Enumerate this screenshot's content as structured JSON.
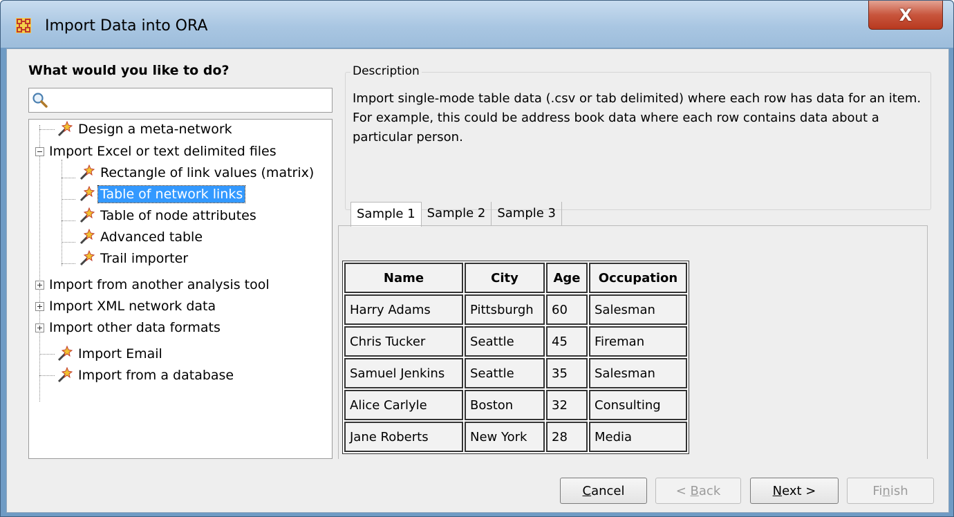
{
  "window": {
    "title": "Import Data into ORA",
    "close_label": "X",
    "accent_color": "#3399ff"
  },
  "left": {
    "heading": "What would you like to do?",
    "search_value": "",
    "tree": [
      {
        "label": "Design a meta-network",
        "icon": "wand-icon"
      },
      {
        "label": "Import Excel or text delimited files",
        "icon": "minus-expander",
        "expanded": true
      },
      {
        "label": "Rectangle of link values (matrix)",
        "icon": "wand-icon"
      },
      {
        "label": "Table of network links",
        "icon": "wand-icon",
        "selected": true
      },
      {
        "label": "Table of node attributes",
        "icon": "wand-icon"
      },
      {
        "label": "Advanced table",
        "icon": "wand-icon"
      },
      {
        "label": "Trail importer",
        "icon": "wand-icon"
      },
      {
        "label": "Import from another analysis tool",
        "icon": "plus-expander",
        "expanded": false
      },
      {
        "label": "Import XML network data",
        "icon": "plus-expander",
        "expanded": false
      },
      {
        "label": "Import other data formats",
        "icon": "plus-expander",
        "expanded": false
      },
      {
        "label": "Import Email",
        "icon": "wand-icon"
      },
      {
        "label": "Import from a database",
        "icon": "wand-icon"
      }
    ]
  },
  "description": {
    "legend": "Description",
    "text": "Import single-mode table data (.csv or tab delimited) where each row has data for an item. For example, this could be address book data where each row contains data about a particular person."
  },
  "tabs": [
    {
      "label": "Sample 1",
      "active": true
    },
    {
      "label": "Sample 2",
      "active": false
    },
    {
      "label": "Sample 3",
      "active": false
    }
  ],
  "sample_table": {
    "headers": [
      "Name",
      "City",
      "Age",
      "Occupation"
    ],
    "rows": [
      [
        "Harry Adams",
        "Pittsburgh",
        "60",
        "Salesman"
      ],
      [
        "Chris Tucker",
        "Seattle",
        "45",
        "Fireman"
      ],
      [
        "Samuel Jenkins",
        "Seattle",
        "35",
        "Salesman"
      ],
      [
        "Alice Carlyle",
        "Boston",
        "32",
        "Consulting"
      ],
      [
        "Jane Roberts",
        "New York",
        "28",
        "Media"
      ]
    ]
  },
  "buttons": {
    "cancel": {
      "pre": "",
      "mn": "C",
      "post": "ancel"
    },
    "back": {
      "pre": "< ",
      "mn": "B",
      "post": "ack"
    },
    "next": {
      "pre": "",
      "mn": "N",
      "post": "ext >"
    },
    "finish": {
      "pre": "Fi",
      "mn": "n",
      "post": "ish"
    }
  }
}
